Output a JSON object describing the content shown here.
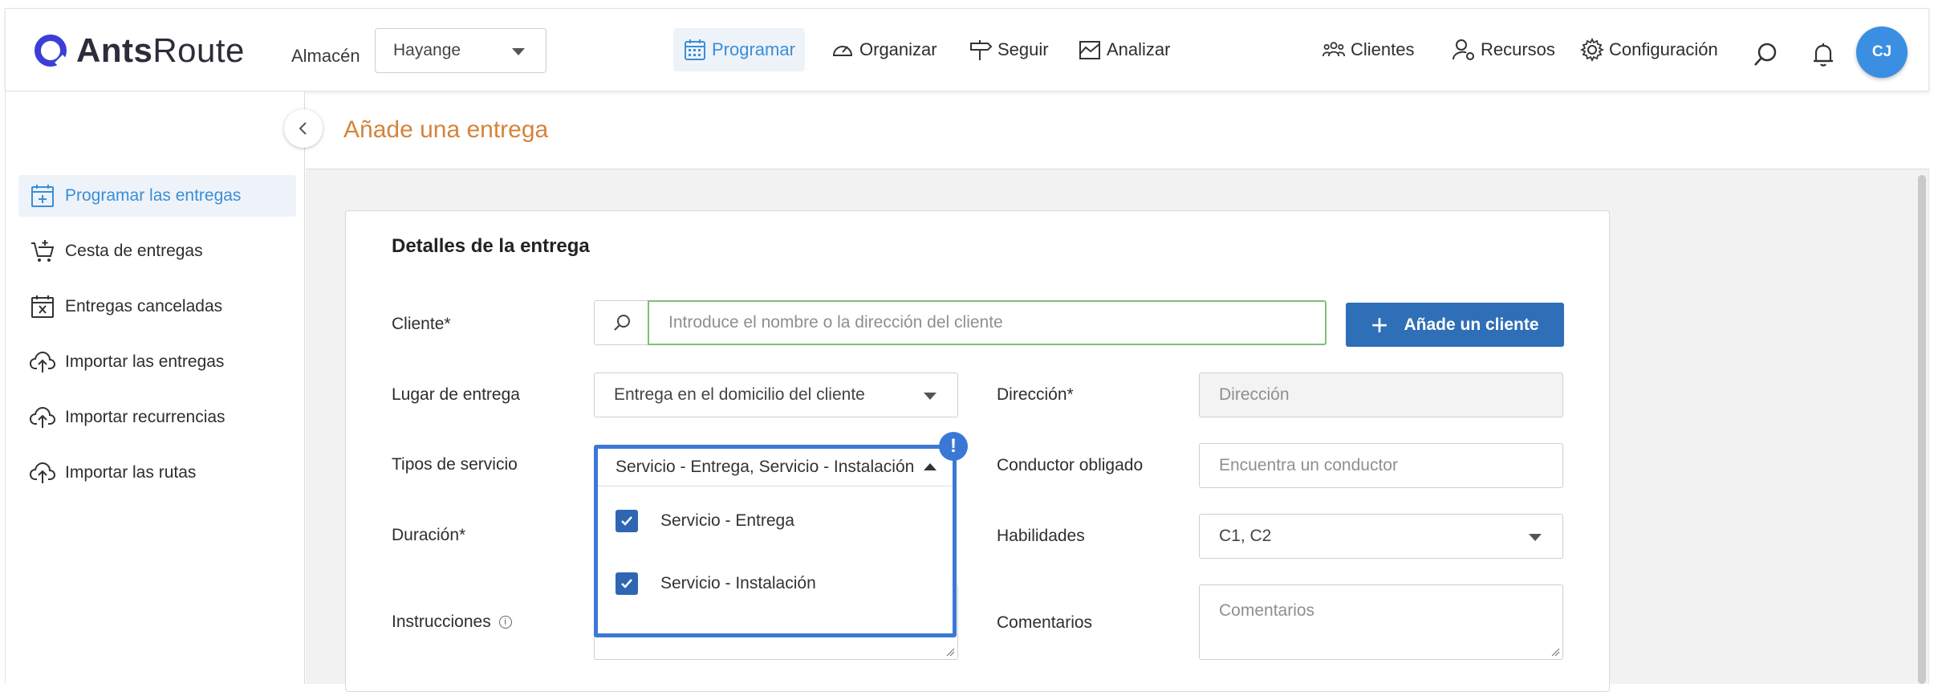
{
  "app": {
    "logo_bold": "Ants",
    "logo_light": "Route"
  },
  "header": {
    "warehouse_label": "Almacén",
    "warehouse_value": "Hayange",
    "nav": {
      "programar": "Programar",
      "organizar": "Organizar",
      "seguir": "Seguir",
      "analizar": "Analizar",
      "clientes": "Clientes",
      "recursos": "Recursos",
      "configuracion": "Configuración"
    },
    "avatar_initials": "CJ",
    "accent_color": "#3a8ed6"
  },
  "sidebar": {
    "items": [
      {
        "label": "Programar las entregas",
        "icon": "calendar-plus-icon",
        "active": true
      },
      {
        "label": "Cesta de entregas",
        "icon": "cart-icon",
        "active": false
      },
      {
        "label": "Entregas canceladas",
        "icon": "calendar-x-icon",
        "active": false
      },
      {
        "label": "Importar las entregas",
        "icon": "cloud-upload-icon",
        "active": false
      },
      {
        "label": "Importar recurrencias",
        "icon": "cloud-upload-icon",
        "active": false
      },
      {
        "label": "Importar las rutas",
        "icon": "cloud-upload-icon",
        "active": false
      }
    ]
  },
  "page": {
    "title": "Añade una entrega",
    "title_color": "#d4843b"
  },
  "form": {
    "section_title": "Detalles de la entrega",
    "cliente_label": "Cliente*",
    "cliente_placeholder": "Introduce el nombre o la dirección del cliente",
    "add_client_label": "Añade un cliente",
    "lugar_label": "Lugar de entrega",
    "lugar_value": "Entrega en el domicilio del cliente",
    "direccion_label": "Dirección*",
    "direccion_placeholder": "Dirección",
    "tipos_label": "Tipos de servicio",
    "tipos_value": "Servicio - Entrega, Servicio - Instalación",
    "tipos_options": [
      {
        "label": "Servicio - Entrega",
        "checked": true
      },
      {
        "label": "Servicio - Instalación",
        "checked": true
      }
    ],
    "conductor_label": "Conductor obligado",
    "conductor_placeholder": "Encuentra un conductor",
    "duracion_label": "Duración*",
    "habilidades_label": "Habilidades",
    "habilidades_value": "C1, C2",
    "instrucciones_label": "Instrucciones",
    "comentarios_label": "Comentarios",
    "comentarios_placeholder": "Comentarios",
    "warning_mark": "!",
    "info_mark": "i"
  }
}
